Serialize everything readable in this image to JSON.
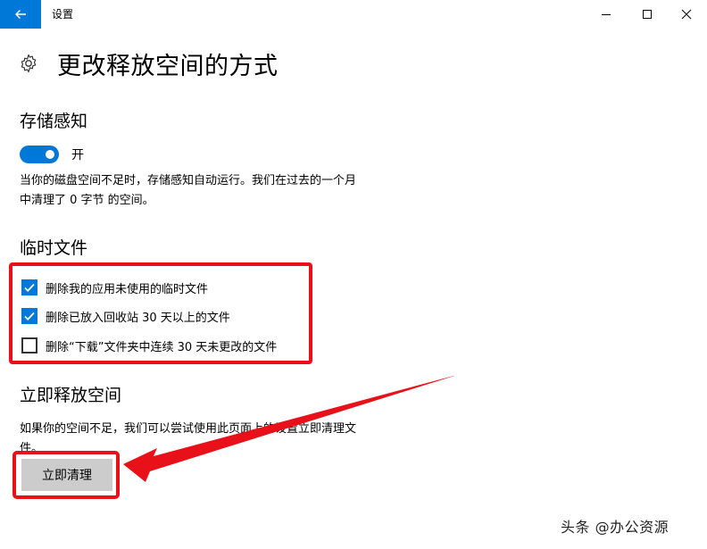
{
  "window": {
    "title": "设置",
    "back_icon": "arrow-left-icon",
    "controls": [
      "minimize-icon",
      "maximize-icon",
      "close-icon"
    ],
    "accent_color": "#0078d7"
  },
  "page": {
    "icon": "gear-icon",
    "title": "更改释放空间的方式"
  },
  "storage_sense": {
    "heading": "存储感知",
    "toggle_state": true,
    "toggle_label": "开",
    "description_line1": "当你的磁盘空间不足时，存储感知自动运行。我们在过去的一个月",
    "description_line2": "中清理了 0 字节 的空间。"
  },
  "temp_files": {
    "heading": "临时文件",
    "options": [
      {
        "label": "删除我的应用未使用的临时文件",
        "checked": true
      },
      {
        "label": "删除已放入回收站 30 天以上的文件",
        "checked": true
      },
      {
        "label": "删除“下载”文件夹中连续 30 天未更改的文件",
        "checked": false
      }
    ]
  },
  "free_now": {
    "heading": "立即释放空间",
    "description_line1": "如果你的空间不足，我们可以尝试使用此页面上的设置立即清理文",
    "description_line2": "件。",
    "button_label": "立即清理"
  },
  "annotation": {
    "highlight_color": "#e8111a",
    "watermark": "头条 @办公资源"
  }
}
